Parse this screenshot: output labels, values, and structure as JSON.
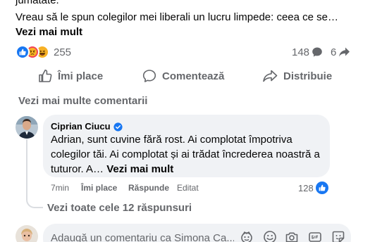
{
  "post": {
    "top_text": "jumătate.",
    "text": "Vreau să le spun colegilor mei liberali un lucru limpede: ceea ce se…",
    "see_more": "Vezi mai mult",
    "reaction_count": "255",
    "comment_count": "148",
    "share_count": "6"
  },
  "actions": {
    "like": "Îmi place",
    "comment": "Comentează",
    "share": "Distribuie"
  },
  "more_comments": "Vezi mai multe comentarii",
  "comment": {
    "author": "Ciprian Ciucu",
    "text": "Adrian, sunt cuvine fără rost. Ai complotat împotriva colegilor tăi. Ai complotat și ai trădat încrederea noastră a tuturor. A… ",
    "see_more": "Vezi mai mult",
    "time": "7min",
    "like": "Îmi place",
    "reply": "Răspunde",
    "edited": "Editat",
    "like_count": "128"
  },
  "replies_link": "Vezi toate cele 12 răspunsuri",
  "composer": {
    "placeholder": "Adaugă un comentariu ca Simona Ca..."
  },
  "colors": {
    "like_blue": "#1877f2",
    "love_red": "#f33e58",
    "haha_yellow": "#f7b125",
    "secondary_text": "#65676b",
    "bubble_bg": "#f0f2f5"
  }
}
